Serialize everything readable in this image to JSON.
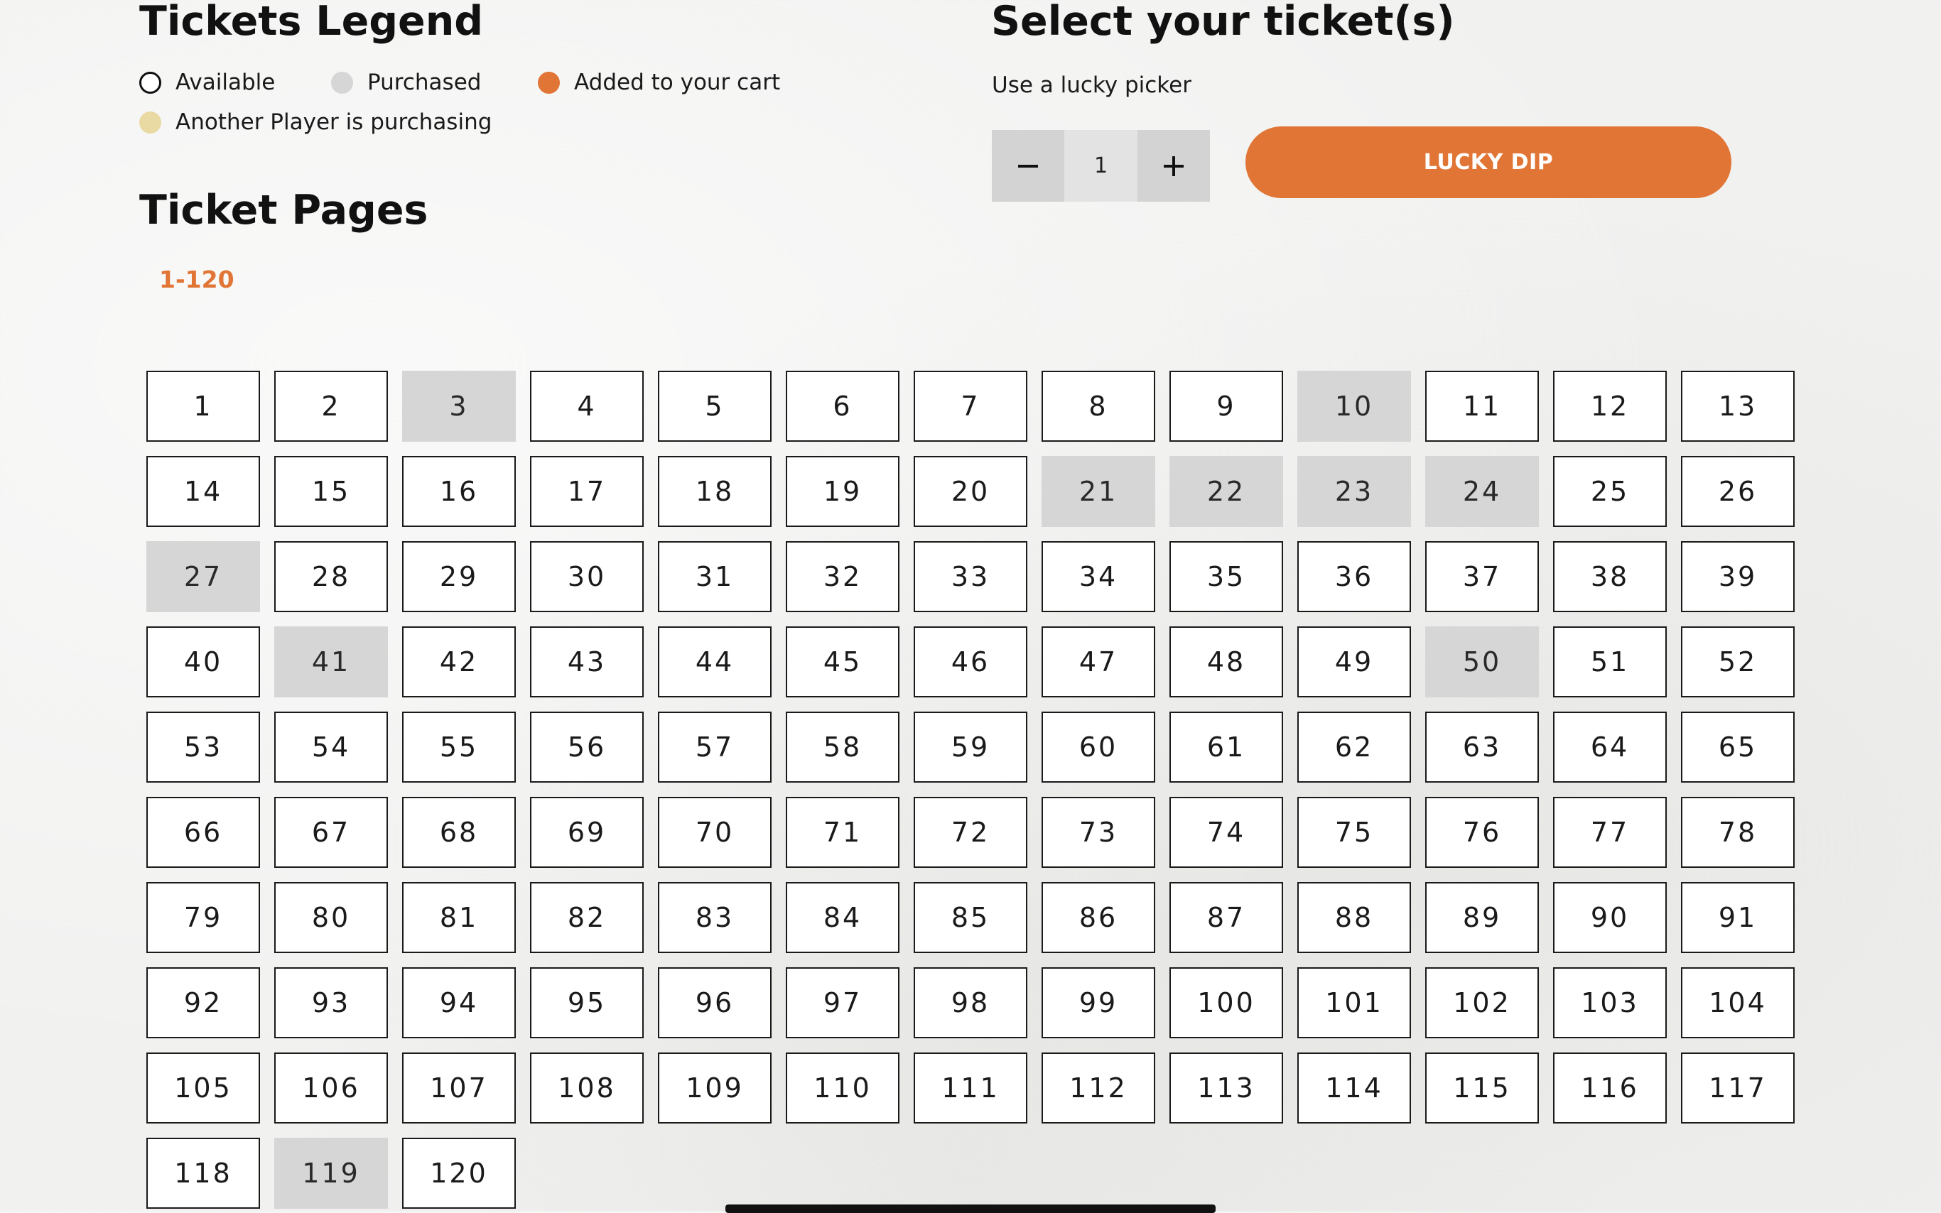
{
  "legend": {
    "title": "Tickets Legend",
    "items": [
      {
        "label": "Available",
        "color": "#ffffff"
      },
      {
        "label": "Purchased",
        "color": "#d6d6d6"
      },
      {
        "label": "Added to your cart",
        "color": "#e07535"
      },
      {
        "label": "Another Player is purchasing",
        "color": "#e9d9a3"
      }
    ]
  },
  "selector": {
    "title": "Select your ticket(s)",
    "subtitle": "Use a lucky picker",
    "quantity": "1",
    "minus_icon": "minus-icon",
    "plus_icon": "plus-icon",
    "lucky_dip_label": "LUCKY DIP"
  },
  "pages": {
    "title": "Ticket Pages",
    "items": [
      "1-120"
    ]
  },
  "colors": {
    "accent": "#e07535",
    "purchased": "#d6d6d6",
    "reserved": "#e9d9a3"
  },
  "tickets": [
    {
      "number": "1",
      "status": "available"
    },
    {
      "number": "2",
      "status": "available"
    },
    {
      "number": "3",
      "status": "purchased"
    },
    {
      "number": "4",
      "status": "available"
    },
    {
      "number": "5",
      "status": "available"
    },
    {
      "number": "6",
      "status": "available"
    },
    {
      "number": "7",
      "status": "available"
    },
    {
      "number": "8",
      "status": "available"
    },
    {
      "number": "9",
      "status": "available"
    },
    {
      "number": "10",
      "status": "purchased"
    },
    {
      "number": "11",
      "status": "available"
    },
    {
      "number": "12",
      "status": "available"
    },
    {
      "number": "13",
      "status": "available"
    },
    {
      "number": "14",
      "status": "available"
    },
    {
      "number": "15",
      "status": "available"
    },
    {
      "number": "16",
      "status": "available"
    },
    {
      "number": "17",
      "status": "available"
    },
    {
      "number": "18",
      "status": "available"
    },
    {
      "number": "19",
      "status": "available"
    },
    {
      "number": "20",
      "status": "available"
    },
    {
      "number": "21",
      "status": "purchased"
    },
    {
      "number": "22",
      "status": "purchased"
    },
    {
      "number": "23",
      "status": "purchased"
    },
    {
      "number": "24",
      "status": "purchased"
    },
    {
      "number": "25",
      "status": "available"
    },
    {
      "number": "26",
      "status": "available"
    },
    {
      "number": "27",
      "status": "purchased"
    },
    {
      "number": "28",
      "status": "available"
    },
    {
      "number": "29",
      "status": "available"
    },
    {
      "number": "30",
      "status": "available"
    },
    {
      "number": "31",
      "status": "available"
    },
    {
      "number": "32",
      "status": "available"
    },
    {
      "number": "33",
      "status": "available"
    },
    {
      "number": "34",
      "status": "available"
    },
    {
      "number": "35",
      "status": "available"
    },
    {
      "number": "36",
      "status": "available"
    },
    {
      "number": "37",
      "status": "available"
    },
    {
      "number": "38",
      "status": "available"
    },
    {
      "number": "39",
      "status": "available"
    },
    {
      "number": "40",
      "status": "available"
    },
    {
      "number": "41",
      "status": "purchased"
    },
    {
      "number": "42",
      "status": "available"
    },
    {
      "number": "43",
      "status": "available"
    },
    {
      "number": "44",
      "status": "available"
    },
    {
      "number": "45",
      "status": "available"
    },
    {
      "number": "46",
      "status": "available"
    },
    {
      "number": "47",
      "status": "available"
    },
    {
      "number": "48",
      "status": "available"
    },
    {
      "number": "49",
      "status": "available"
    },
    {
      "number": "50",
      "status": "purchased"
    },
    {
      "number": "51",
      "status": "available"
    },
    {
      "number": "52",
      "status": "available"
    },
    {
      "number": "53",
      "status": "available"
    },
    {
      "number": "54",
      "status": "available"
    },
    {
      "number": "55",
      "status": "available"
    },
    {
      "number": "56",
      "status": "available"
    },
    {
      "number": "57",
      "status": "available"
    },
    {
      "number": "58",
      "status": "available"
    },
    {
      "number": "59",
      "status": "available"
    },
    {
      "number": "60",
      "status": "available"
    },
    {
      "number": "61",
      "status": "available"
    },
    {
      "number": "62",
      "status": "available"
    },
    {
      "number": "63",
      "status": "available"
    },
    {
      "number": "64",
      "status": "available"
    },
    {
      "number": "65",
      "status": "available"
    },
    {
      "number": "66",
      "status": "available"
    },
    {
      "number": "67",
      "status": "available"
    },
    {
      "number": "68",
      "status": "available"
    },
    {
      "number": "69",
      "status": "available"
    },
    {
      "number": "70",
      "status": "available"
    },
    {
      "number": "71",
      "status": "available"
    },
    {
      "number": "72",
      "status": "available"
    },
    {
      "number": "73",
      "status": "available"
    },
    {
      "number": "74",
      "status": "available"
    },
    {
      "number": "75",
      "status": "available"
    },
    {
      "number": "76",
      "status": "available"
    },
    {
      "number": "77",
      "status": "available"
    },
    {
      "number": "78",
      "status": "available"
    },
    {
      "number": "79",
      "status": "available"
    },
    {
      "number": "80",
      "status": "available"
    },
    {
      "number": "81",
      "status": "available"
    },
    {
      "number": "82",
      "status": "available"
    },
    {
      "number": "83",
      "status": "available"
    },
    {
      "number": "84",
      "status": "available"
    },
    {
      "number": "85",
      "status": "available"
    },
    {
      "number": "86",
      "status": "available"
    },
    {
      "number": "87",
      "status": "available"
    },
    {
      "number": "88",
      "status": "available"
    },
    {
      "number": "89",
      "status": "available"
    },
    {
      "number": "90",
      "status": "available"
    },
    {
      "number": "91",
      "status": "available"
    },
    {
      "number": "92",
      "status": "available"
    },
    {
      "number": "93",
      "status": "available"
    },
    {
      "number": "94",
      "status": "available"
    },
    {
      "number": "95",
      "status": "available"
    },
    {
      "number": "96",
      "status": "available"
    },
    {
      "number": "97",
      "status": "available"
    },
    {
      "number": "98",
      "status": "available"
    },
    {
      "number": "99",
      "status": "available"
    },
    {
      "number": "100",
      "status": "available"
    },
    {
      "number": "101",
      "status": "available"
    },
    {
      "number": "102",
      "status": "available"
    },
    {
      "number": "103",
      "status": "available"
    },
    {
      "number": "104",
      "status": "available"
    },
    {
      "number": "105",
      "status": "available"
    },
    {
      "number": "106",
      "status": "available"
    },
    {
      "number": "107",
      "status": "available"
    },
    {
      "number": "108",
      "status": "available"
    },
    {
      "number": "109",
      "status": "available"
    },
    {
      "number": "110",
      "status": "available"
    },
    {
      "number": "111",
      "status": "available"
    },
    {
      "number": "112",
      "status": "available"
    },
    {
      "number": "113",
      "status": "available"
    },
    {
      "number": "114",
      "status": "available"
    },
    {
      "number": "115",
      "status": "available"
    },
    {
      "number": "116",
      "status": "available"
    },
    {
      "number": "117",
      "status": "available"
    },
    {
      "number": "118",
      "status": "available"
    },
    {
      "number": "119",
      "status": "purchased"
    },
    {
      "number": "120",
      "status": "available"
    }
  ]
}
